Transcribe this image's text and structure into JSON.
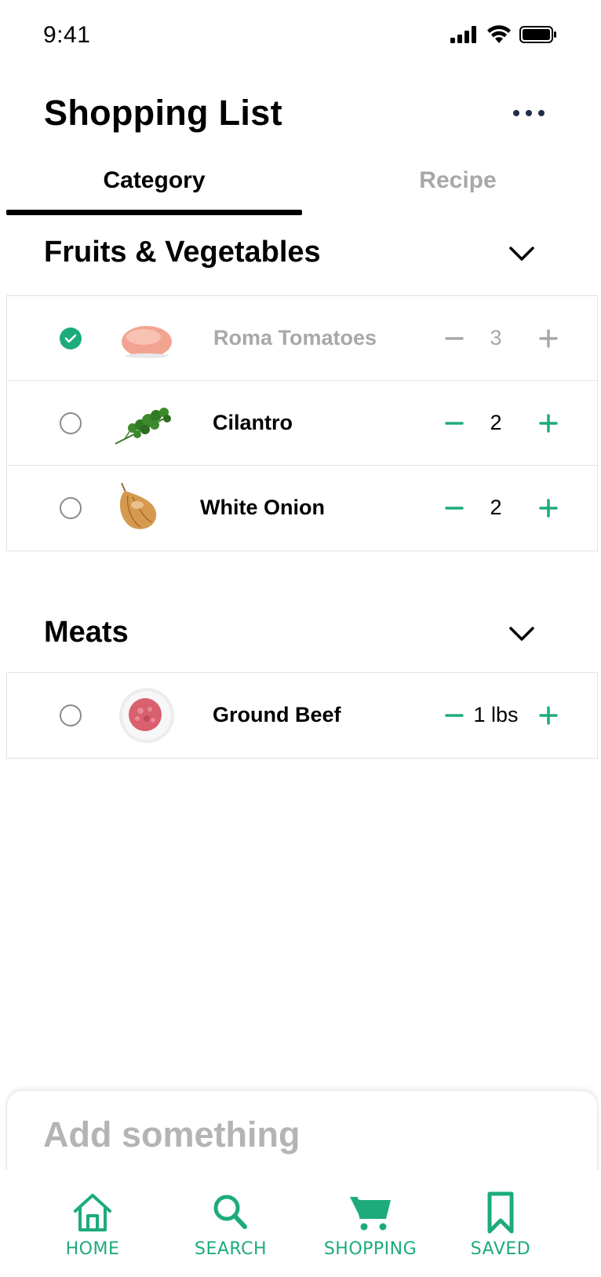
{
  "status_bar": {
    "time": "9:41",
    "icons": [
      "signal-icon",
      "wifi-icon",
      "battery-icon"
    ]
  },
  "header": {
    "title": "Shopping List",
    "more_icon": "more-icon"
  },
  "tabs": [
    {
      "label": "Category",
      "active": true
    },
    {
      "label": "Recipe",
      "active": false
    }
  ],
  "sections": [
    {
      "title": "Fruits & Vegetables",
      "items": [
        {
          "name": "Roma Tomatoes",
          "qty": "3",
          "checked": true,
          "image": "tomato-image"
        },
        {
          "name": "Cilantro",
          "qty": "2",
          "checked": false,
          "image": "cilantro-image"
        },
        {
          "name": "White Onion",
          "qty": "2",
          "checked": false,
          "image": "onion-image"
        }
      ]
    },
    {
      "title": "Meats",
      "items": [
        {
          "name": "Ground Beef",
          "qty": "1 lbs",
          "checked": false,
          "image": "ground-beef-image"
        }
      ]
    }
  ],
  "add_panel": {
    "placeholder": "Add something"
  },
  "tabbar": {
    "items": [
      {
        "label": "HOME",
        "icon": "home-icon"
      },
      {
        "label": "SEARCH",
        "icon": "search-icon"
      },
      {
        "label": "SHOPPING",
        "icon": "cart-icon"
      },
      {
        "label": "SAVED",
        "icon": "bookmark-icon"
      }
    ]
  },
  "colors": {
    "accent": "#1dab7c",
    "muted_text": "#a8a8a8",
    "divider": "#e2e2e2"
  }
}
